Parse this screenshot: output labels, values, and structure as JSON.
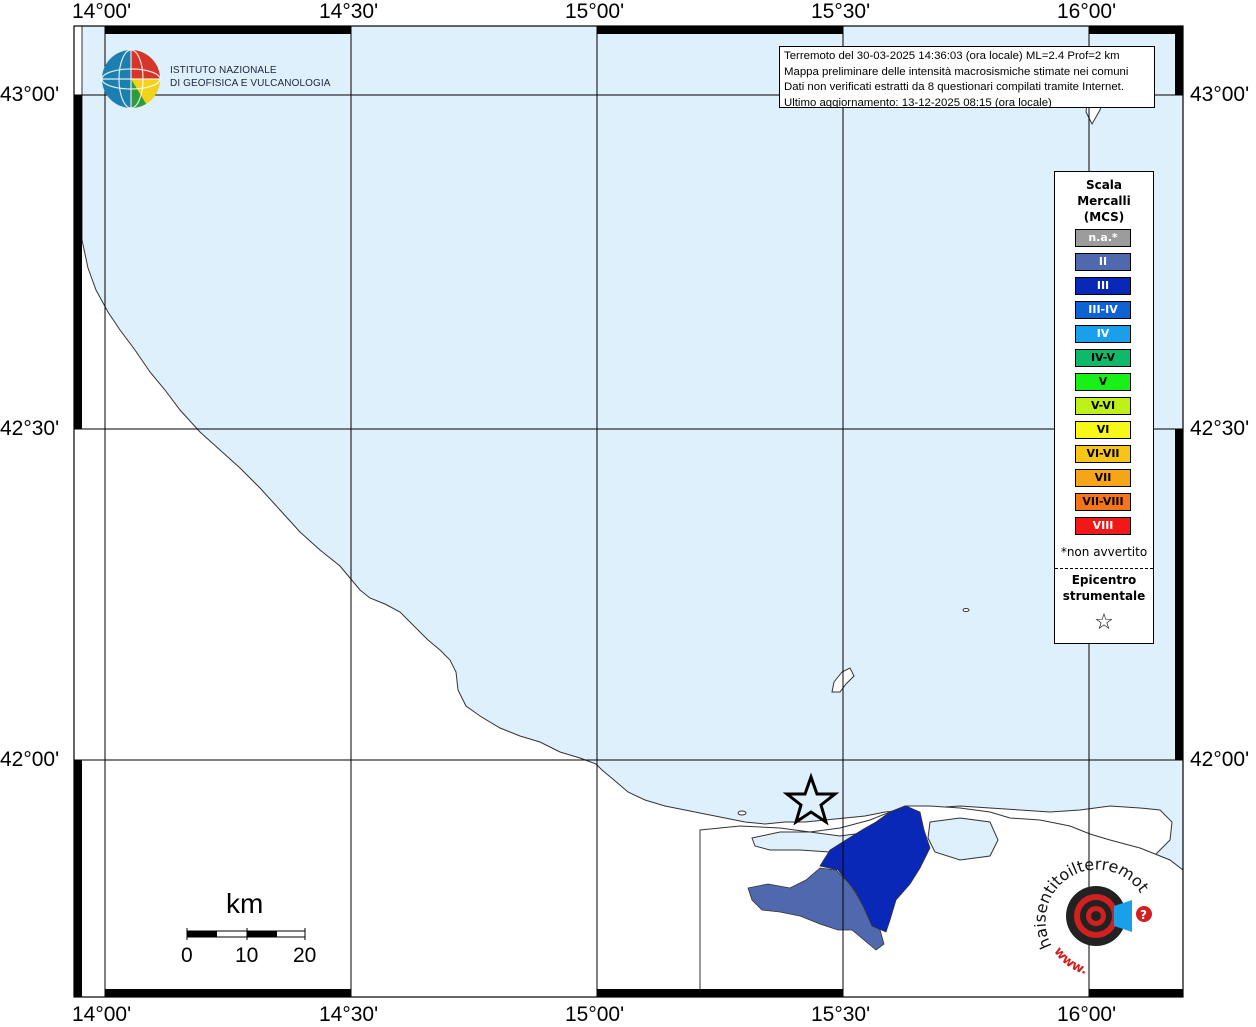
{
  "map": {
    "tick_labels": {
      "lon": [
        "14°00'",
        "14°30'",
        "15°00'",
        "15°30'",
        "16°00'"
      ],
      "lat": [
        "43°00'",
        "42°30'",
        "42°00'"
      ]
    },
    "colors": {
      "sea": "#dff0fd",
      "land": "#ffffff",
      "coast": "#333333",
      "grid": "#000000"
    },
    "affected_areas": [
      {
        "intensity": "II",
        "color": "#5068ad"
      },
      {
        "intensity": "III",
        "color": "#0a28b8"
      }
    ],
    "epicenter": {
      "symbol": "star"
    }
  },
  "info_box": {
    "line1": "Terremoto del 30-03-2025 14:36:03 (ora locale) ML=2.4 Prof=2 km",
    "line2": "Mappa preliminare delle intensità macrosismiche stimate nei comuni",
    "line3": "Dati non verificati estratti da 8 questionari compilati tramite Internet.",
    "line4": "Ultimo aggiornamento: 13-12-2025 08:15 (ora locale)"
  },
  "legend": {
    "title_line1": "Scala",
    "title_line2": "Mercalli",
    "title_line3": "(MCS)",
    "items": [
      {
        "label": "n.a.*",
        "color": "#9c9c9c",
        "text_color": "#ffffff"
      },
      {
        "label": "II",
        "color": "#5068ad",
        "text_color": "#ffffff"
      },
      {
        "label": "III",
        "color": "#0a28b8",
        "text_color": "#ffffff"
      },
      {
        "label": "III-IV",
        "color": "#0f62d4",
        "text_color": "#ffffff"
      },
      {
        "label": "IV",
        "color": "#1aa0ea",
        "text_color": "#ffffff"
      },
      {
        "label": "IV-V",
        "color": "#10b86a",
        "text_color": "#000000"
      },
      {
        "label": "V",
        "color": "#18f018",
        "text_color": "#000000"
      },
      {
        "label": "V-VI",
        "color": "#bff018",
        "text_color": "#000000"
      },
      {
        "label": "VI",
        "color": "#f7f718",
        "text_color": "#000000"
      },
      {
        "label": "VI-VII",
        "color": "#f7c518",
        "text_color": "#000000"
      },
      {
        "label": "VII",
        "color": "#f7a518",
        "text_color": "#000000"
      },
      {
        "label": "VII-VIII",
        "color": "#f77518",
        "text_color": "#000000"
      },
      {
        "label": "VIII",
        "color": "#f21818",
        "text_color": "#ffffff"
      }
    ],
    "note": "*non avvertito",
    "epicenter_line1": "Epicentro",
    "epicenter_line2": "strumentale",
    "epicenter_icon": "star-outline-icon"
  },
  "ingv_logo": {
    "line1": "ISTITUTO NAZIONALE",
    "line2": "DI GEOFISICA E VULCANOLOGIA"
  },
  "scalebar": {
    "unit": "km",
    "labels": [
      "0",
      "10",
      "20"
    ]
  },
  "hst_logo": {
    "text": "haisentitoilterremoto.it",
    "prefix": "www."
  }
}
